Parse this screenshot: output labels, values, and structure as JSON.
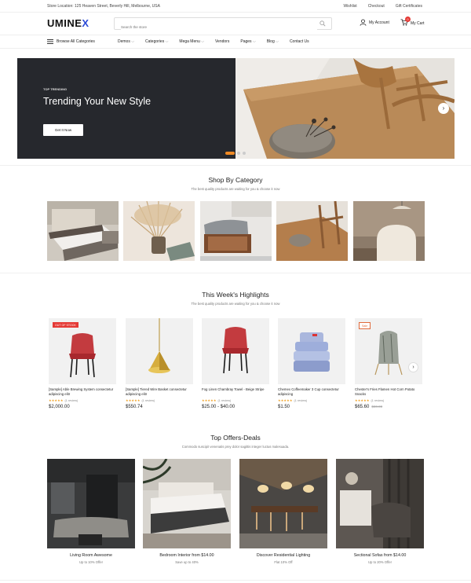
{
  "topbar": {
    "location": "Store Location: 125 Heaven Street, Beverly Hill, Melbourne, USA",
    "links": [
      "Wishlist",
      "Checkout",
      "Gift Certificates"
    ]
  },
  "header": {
    "logo_main": "UMINE",
    "logo_accent": "X",
    "search_placeholder": "Search the store",
    "account_label": "My Account",
    "cart_label": "My Cart",
    "cart_count": "0"
  },
  "nav": {
    "browse_label": "Browse All Categories",
    "items": [
      "Demos",
      "Categories",
      "Mega Menu",
      "Vendors",
      "Pages",
      "Blog",
      "Contact Us"
    ]
  },
  "hero": {
    "subtitle": "TOP TRENDING",
    "title": "Trending Your New Style",
    "button": "Get It Now"
  },
  "categories": {
    "title": "Shop By Category",
    "subtitle": "The best quality products are waiting for you & choose it now"
  },
  "highlights": {
    "title": "This Week's Highlights",
    "subtitle": "The best quality products are waiting for you & choose it now",
    "products": [
      {
        "tag": "OUT OF STOCK",
        "name": "[Sample] Able Brewing System consectetur adipiscing elitr",
        "stars": "★★★★★",
        "reviews": "(1 review)",
        "price": "$2,000.00",
        "old_price": ""
      },
      {
        "tag": "",
        "name": "[Sample] Tiered Wire Basket consectetur adipiscing elitr",
        "stars": "★★★★★",
        "reviews": "(1 review)",
        "price": "$550.74",
        "old_price": ""
      },
      {
        "tag": "",
        "name": "Fog Linen Chambray Towel - Beige Stripe",
        "stars": "★★★★★",
        "reviews": "(1 review)",
        "price": "$25.00 - $40.00",
        "old_price": ""
      },
      {
        "tag": "",
        "name": "Chemex Coffeemaker 3 Cup consectetur adipiscing",
        "stars": "★★★★★",
        "reviews": "(1 review)",
        "price": "$1.50",
        "old_price": ""
      },
      {
        "tag": "Sale",
        "name": "Chester's Fries Flamen Hot Corn Potato Snacks",
        "stars": "★★★★★",
        "reviews": "(1 review)",
        "price": "$65.60",
        "old_price": "$80.00"
      }
    ]
  },
  "offers": {
    "title": "Top Offers-Deals",
    "subtitle": "Commodo suscipit venenatis prey dolor sagittis integer luctus malesuada.",
    "items": [
      {
        "title": "Living Room Awesome",
        "sub": "Up to 10% Offer"
      },
      {
        "title": "Bedroom Interior from $14.00",
        "sub": "Save up to 40%"
      },
      {
        "title": "Discover Residential Lighting",
        "sub": "Flat 10% Off"
      },
      {
        "title": "Sectional Sofas from $14.00",
        "sub": "Up to 20% Offer"
      }
    ]
  },
  "colors": {
    "accent": "#2c4bd6",
    "sale_red": "#e53935",
    "star": "#f0a020",
    "hero_dark": "#26282d",
    "slider_active": "#f08a24"
  }
}
